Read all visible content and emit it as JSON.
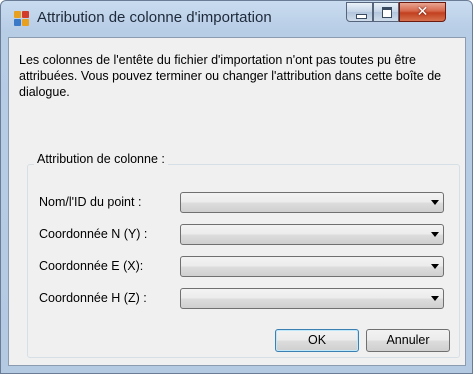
{
  "window": {
    "title": "Attribution de colonne d'importation",
    "icon": "app-icon",
    "controls": {
      "minimize": "minimize-icon",
      "maximize": "maximize-icon",
      "close_glyph": "✕"
    }
  },
  "message": "Les colonnes de l'entête du fichier d'importation n'ont pas toutes pu être attribuées. Vous pouvez terminer ou changer l'attribution dans cette boîte de dialogue.",
  "group": {
    "label": "Attribution de colonne :",
    "fields": [
      {
        "label": "Nom/l'ID du point :",
        "value": ""
      },
      {
        "label": "Coordonnée N (Y) :",
        "value": ""
      },
      {
        "label": "Coordonnée E (X):",
        "value": ""
      },
      {
        "label": "Coordonnée H (Z) :",
        "value": ""
      }
    ]
  },
  "buttons": {
    "ok": "OK",
    "cancel": "Annuler"
  }
}
